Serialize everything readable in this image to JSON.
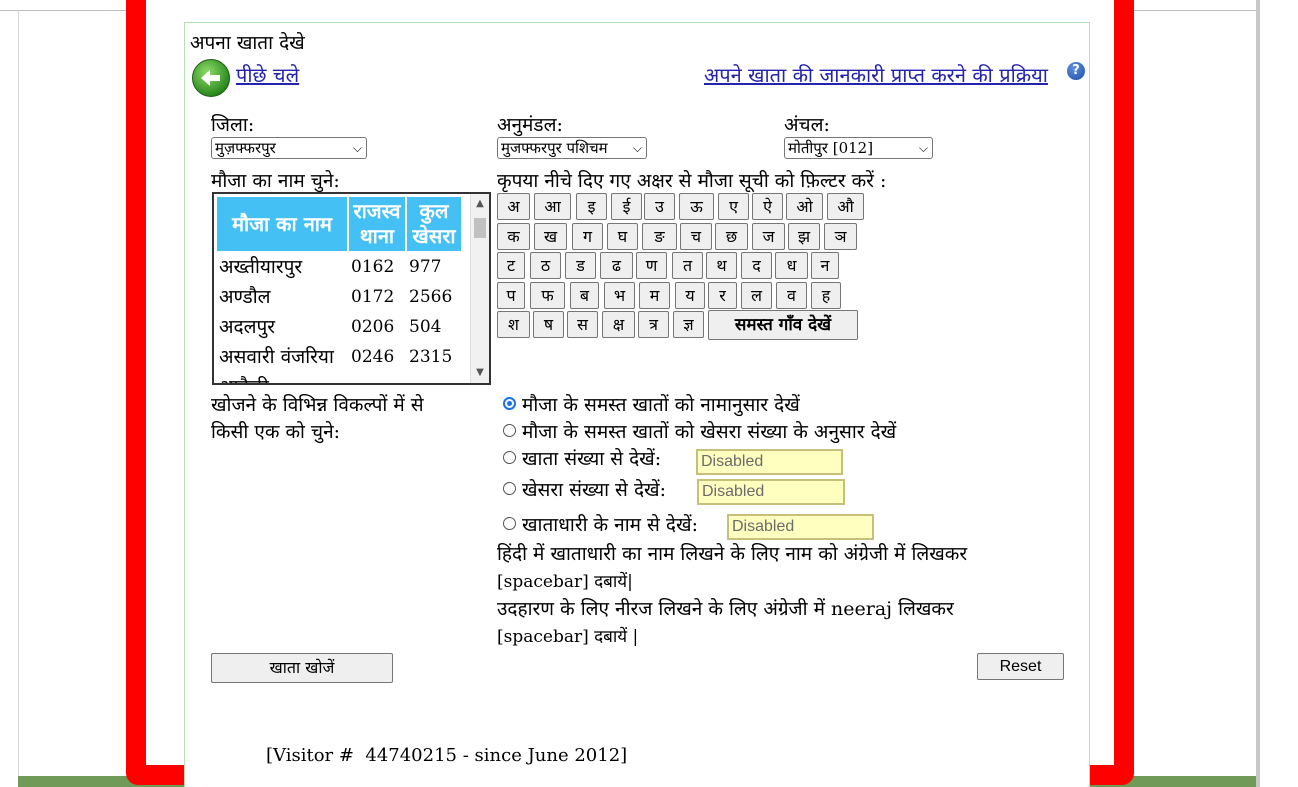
{
  "page": {
    "title": "अपना खाता देखे"
  },
  "nav": {
    "back_label": "पीछे चले",
    "process_link": "अपने खाता की जानकारी प्राप्त करने की प्रक्रिया",
    "help_glyph": "?"
  },
  "filters": {
    "district_label": "जिला:",
    "district_value": "मुज़फ्फरपुर",
    "subdivision_label": "अनुमंडल:",
    "subdivision_value": "मुजफ्फरपुर पशिचम",
    "circle_label": "अंचल:",
    "circle_value": "मोतीपुर [012]"
  },
  "mauza": {
    "label": "मौजा का नाम चुने:",
    "headers": [
      "मौजा का नाम",
      "राजस्व थाना",
      "कुल खेसरा"
    ],
    "rows": [
      {
        "name": "अख्तीयारपुर",
        "thana": "0162",
        "khesra": "977"
      },
      {
        "name": "अण्डौल",
        "thana": "0172",
        "khesra": "2566"
      },
      {
        "name": "अदलपुर",
        "thana": "0206",
        "khesra": "504"
      },
      {
        "name": "असवारी वंजरिया",
        "thana": "0246",
        "khesra": "2315"
      },
      {
        "name": "आकैठी",
        "thana": "",
        "khesra": ""
      }
    ]
  },
  "keyboard": {
    "instruction": "कृपया नीचे दिए गए अक्षर से मौजा सूची को फ़िल्टर करें :",
    "rows": [
      [
        "अ",
        "आ",
        "इ",
        "ई",
        "उ",
        "ऊ",
        "ए",
        "ऐ",
        "ओ",
        "औ"
      ],
      [
        "क",
        "ख",
        "ग",
        "घ",
        "ङ",
        "च",
        "छ",
        "ज",
        "झ",
        "ञ"
      ],
      [
        "ट",
        "ठ",
        "ड",
        "ढ",
        "ण",
        "त",
        "थ",
        "द",
        "ध",
        "न"
      ],
      [
        "प",
        "फ",
        "ब",
        "भ",
        "म",
        "य",
        "र",
        "ल",
        "व",
        "ह"
      ],
      [
        "श",
        "ष",
        "स",
        "क्ष",
        "त्र",
        "ज्ञ"
      ]
    ],
    "all_villages_label": "समस्त गाँव देखें"
  },
  "options": {
    "label_line1": "खोजने के विभिन्न विकल्पों में से",
    "label_line2": "किसी एक को चुने:",
    "radio_by_name": "मौजा के समस्त खातों को नामानुसार देखें",
    "radio_by_khesra_count": "मौजा के समस्त खातों को खेसरा संख्या के अनुसार देखें",
    "radio_by_khata_no": "खाता संख्या से देखें:",
    "radio_by_khesra_no": "खेसरा संख्या से देखें:",
    "radio_by_owner": "खाताधारी के नाम से देखें:",
    "disabled_value": "Disabled",
    "hint1_line1": "हिंदी में खाताधारी का नाम लिखने के लिए नाम को अंग्रेजी में लिखकर",
    "hint1_line2": "[spacebar] दबायें|",
    "hint2_line1": "उदहारण के लिए नीरज लिखने के लिए अंग्रेजी में neeraj लिखकर",
    "hint2_line2": "[spacebar] दबायें |"
  },
  "actions": {
    "search_label": "खाता खोजें",
    "reset_label": "Reset"
  },
  "footer": {
    "visitor_text": "[Visitor #  44740215 - since June 2012]"
  }
}
